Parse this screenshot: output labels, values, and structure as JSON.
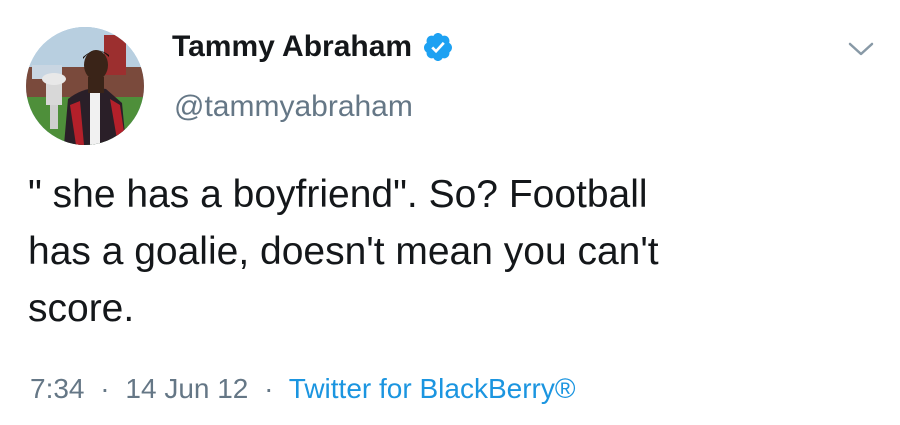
{
  "author": {
    "display_name": "Tammy Abraham",
    "handle": "@tammyabraham",
    "verified": true
  },
  "tweet": {
    "text_lines": [
      "\" she has a boyfriend\". So? Football",
      "has a goalie, doesn't mean you can't",
      "score."
    ],
    "time": "7:34",
    "date": "14 Jun 12",
    "separator": "·",
    "source": "Twitter for BlackBerry®"
  },
  "icons": {
    "verified": "verified-badge-icon",
    "menu": "chevron-down-icon"
  },
  "colors": {
    "accent": "#1b95e0",
    "verified_badge": "#1da1f2",
    "secondary_text": "#657786",
    "primary_text": "#14171a"
  }
}
